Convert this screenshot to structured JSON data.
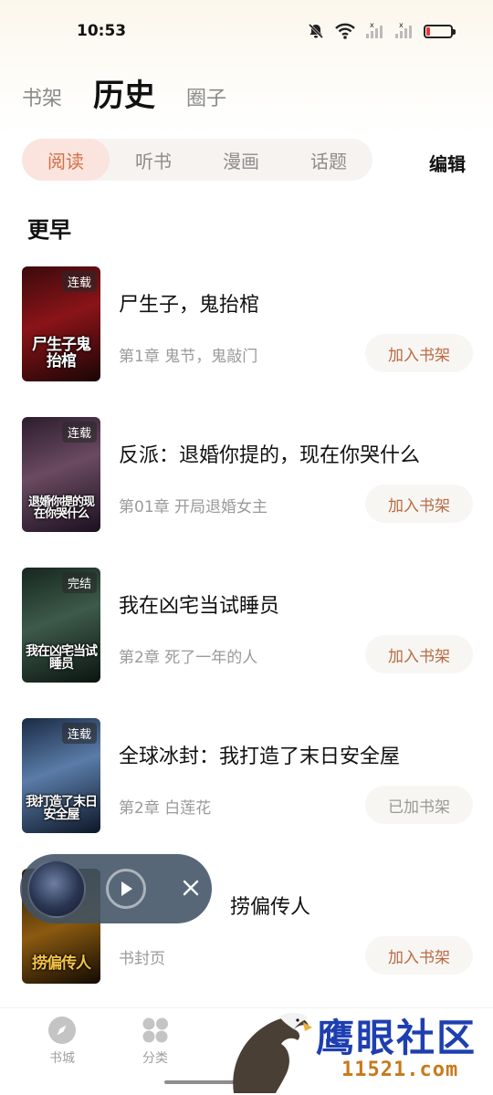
{
  "status_bar": {
    "time": "10:53"
  },
  "main_tabs": [
    {
      "label": "书架",
      "active": false
    },
    {
      "label": "历史",
      "active": true
    },
    {
      "label": "圈子",
      "active": false
    }
  ],
  "sub_tabs": [
    {
      "label": "阅读",
      "active": true
    },
    {
      "label": "听书",
      "active": false
    },
    {
      "label": "漫画",
      "active": false
    },
    {
      "label": "话题",
      "active": false
    }
  ],
  "edit_label": "编辑",
  "section_title": "更早",
  "books": [
    {
      "badge": "连载",
      "cover_text": "尸生子鬼抬棺",
      "title": "尸生子，鬼抬棺",
      "chapter": "第1章 鬼节，鬼敲门",
      "button": "加入书架",
      "cover_colors": [
        "#3a0a0c",
        "#8a1418",
        "#1a0506"
      ]
    },
    {
      "badge": "连载",
      "cover_text": "退婚你提的现在你哭什么",
      "title": "反派：退婚你提的，现在你哭什么",
      "chapter": "第01章 开局退婚女主",
      "button": "加入书架",
      "cover_colors": [
        "#2c1c2e",
        "#6a4a60",
        "#1b1020"
      ]
    },
    {
      "badge": "完结",
      "cover_text": "我在凶宅当试睡员",
      "title": "我在凶宅当试睡员",
      "chapter": "第2章 死了一年的人",
      "button": "加入书架",
      "cover_colors": [
        "#16261f",
        "#3d5a4a",
        "#0b1410"
      ]
    },
    {
      "badge": "连载",
      "cover_text": "我打造了末日安全屋",
      "title": "全球冰封：我打造了末日安全屋",
      "chapter": "第2章 白莲花",
      "button": "已加书架",
      "cover_colors": [
        "#1a2a44",
        "#5a7ca8",
        "#0d1626"
      ]
    },
    {
      "badge": "",
      "cover_text": "捞偏传人",
      "title": "捞偏传人",
      "chapter": "书封页",
      "button": "加入书架",
      "cover_colors": [
        "#2a1a08",
        "#8a5a10",
        "#120a02"
      ]
    }
  ],
  "bottom_nav": [
    {
      "label": "书城",
      "icon": "compass-icon"
    },
    {
      "label": "分类",
      "icon": "grid-icon"
    }
  ],
  "watermark": {
    "text": "鹰眼社区",
    "url": "11521.com"
  }
}
